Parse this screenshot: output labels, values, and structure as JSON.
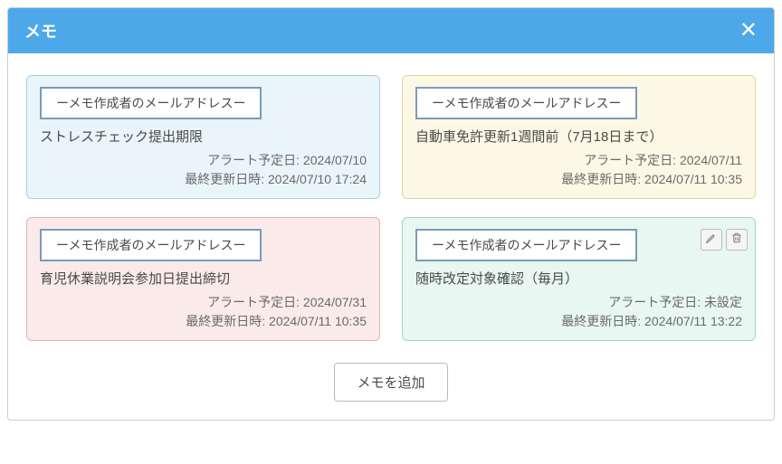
{
  "header": {
    "title": "メモ"
  },
  "labels": {
    "alert_date_prefix": "アラート予定日: ",
    "updated_prefix": "最終更新日時: ",
    "add_button": "メモを追加"
  },
  "memos": [
    {
      "color": "blue",
      "author": "ーメモ作成者のメールアドレスー",
      "title": "ストレスチェック提出期限",
      "alert_date": "2024/07/10",
      "updated": "2024/07/10 17:24",
      "show_actions": false
    },
    {
      "color": "yellow",
      "author": "ーメモ作成者のメールアドレスー",
      "title": "自動車免許更新1週間前（7月18日まで）",
      "alert_date": "2024/07/11",
      "updated": "2024/07/11 10:35",
      "show_actions": false
    },
    {
      "color": "red",
      "author": "ーメモ作成者のメールアドレスー",
      "title": "育児休業説明会参加日提出締切",
      "alert_date": "2024/07/31",
      "updated": "2024/07/11 10:35",
      "show_actions": false
    },
    {
      "color": "green",
      "author": "ーメモ作成者のメールアドレスー",
      "title": "随時改定対象確認（毎月）",
      "alert_date": "未設定",
      "updated": "2024/07/11 13:22",
      "show_actions": true
    }
  ]
}
